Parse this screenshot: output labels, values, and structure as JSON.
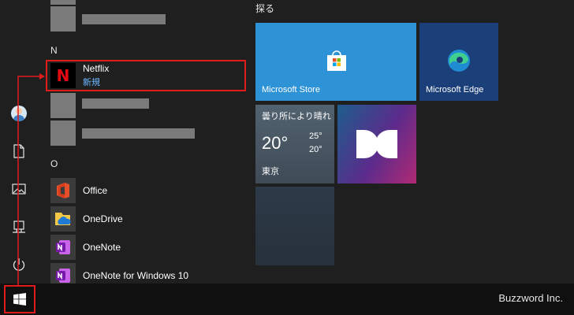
{
  "app_list": {
    "letter_n": "N",
    "letter_o": "O",
    "items": [
      {
        "name": "Netflix",
        "sub": "新規",
        "icon": "netflix-icon"
      },
      {
        "name": "Office",
        "icon": "office-icon"
      },
      {
        "name": "OneDrive",
        "icon": "onedrive-icon"
      },
      {
        "name": "OneNote",
        "icon": "onenote-icon"
      },
      {
        "name": "OneNote for Windows 10",
        "icon": "onenote-icon"
      }
    ]
  },
  "tiles": {
    "group_title": "探る",
    "store": {
      "label": "Microsoft Store",
      "color": "#2d93d6"
    },
    "edge": {
      "label": "Microsoft Edge",
      "color": "#1b3f78"
    },
    "weather": {
      "condition": "曇り所により晴れ",
      "temp": "20°",
      "high": "25°",
      "low": "20°",
      "city": "東京"
    },
    "dolby": {
      "icon": "dolby-icon"
    }
  },
  "taskbar": {
    "start_icon": "windows-logo-icon",
    "watermark": "Buzzword Inc."
  },
  "highlight_color": "#e11b1b"
}
